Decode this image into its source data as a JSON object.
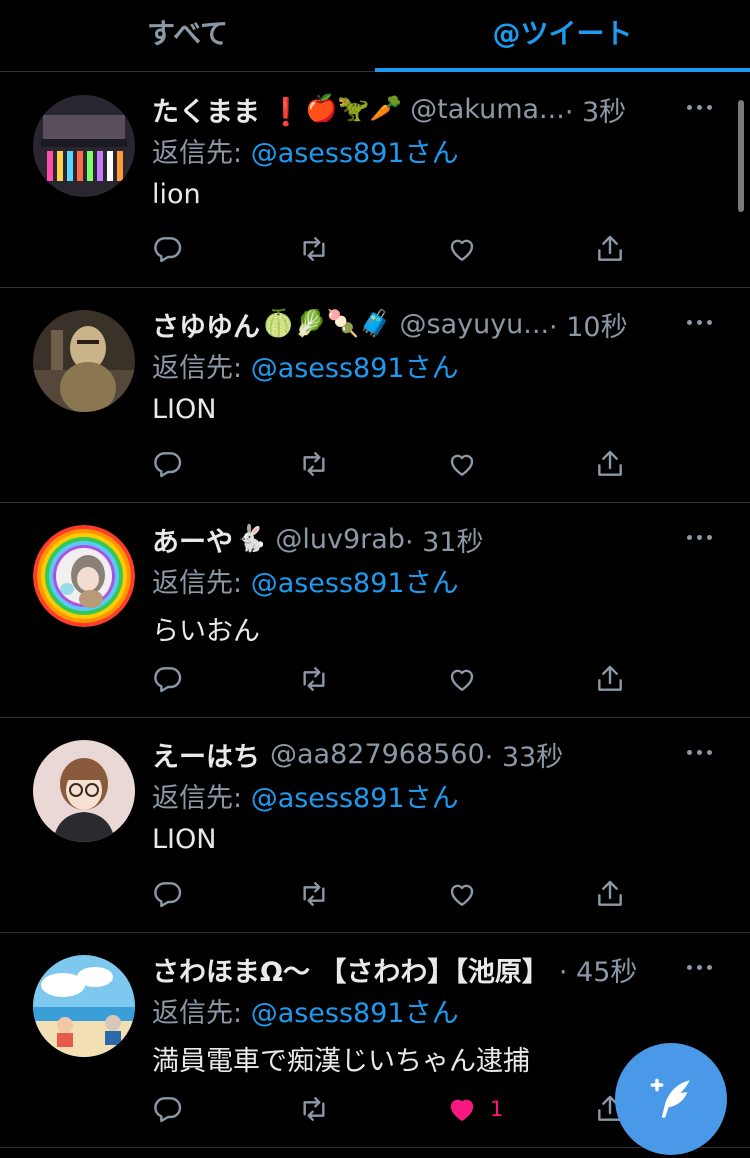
{
  "tabs": [
    {
      "label": "すべて",
      "active": false
    },
    {
      "label": "@ツイート",
      "active": true
    }
  ],
  "tweets": [
    {
      "name": "たくまま ❗",
      "emojis": "🍎🦖🥕",
      "handle": "@takuma...",
      "time": "· 3秒",
      "reply_prefix": "返信先: ",
      "reply_to": "@asess891さん",
      "text": "lion",
      "likes": "",
      "liked": false
    },
    {
      "name": "さゆゆん",
      "emojis": "🍈🥬🍡🧳",
      "handle": "@sayuyu...",
      "time": "· 10秒",
      "reply_prefix": "返信先: ",
      "reply_to": "@asess891さん",
      "text": "LION",
      "likes": "",
      "liked": false
    },
    {
      "name": "あーや",
      "emojis": "🐇",
      "handle": "@luv9rab",
      "time": "· 31秒",
      "reply_prefix": "返信先: ",
      "reply_to": "@asess891さん",
      "text": "らいおん",
      "likes": "",
      "liked": false
    },
    {
      "name": "えーはち",
      "emojis": "",
      "handle": "@aa827968560",
      "time": "· 33秒",
      "reply_prefix": "返信先: ",
      "reply_to": "@asess891さん",
      "text": "LION",
      "likes": "",
      "liked": false
    },
    {
      "name": "さわほまΩ〜 【さわわ】【池原】",
      "emojis": "",
      "handle": "",
      "time": "· 45秒",
      "reply_prefix": "返信先: ",
      "reply_to": "@asess891さん",
      "text": "満員電車で痴漢じいちゃん逮捕",
      "likes": "1",
      "liked": true
    }
  ],
  "colors": {
    "accent": "#1d9bf0",
    "like": "#f91880",
    "secondary_text": "#8b98a5",
    "fab": "#4a99e9"
  },
  "icons": {
    "reply": "reply-icon",
    "retweet": "retweet-icon",
    "like": "heart-icon",
    "share": "share-icon",
    "more": "more-dots-icon",
    "compose": "compose-feather-icon"
  }
}
